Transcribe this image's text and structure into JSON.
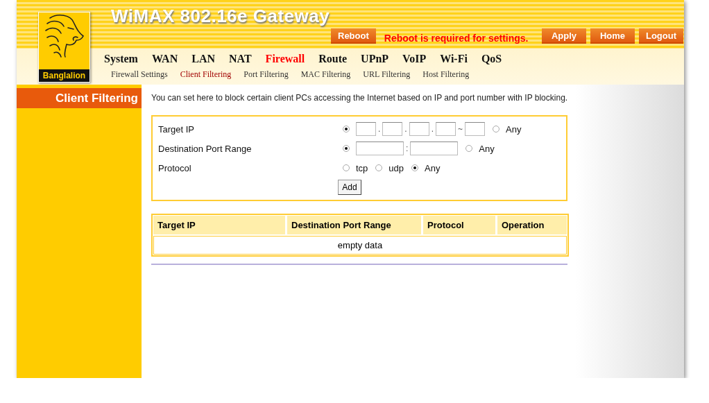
{
  "header": {
    "title": "WiMAX 802.16e Gateway",
    "logo_text": "Banglalion",
    "reboot_button": "Reboot",
    "notice": "Reboot is required for settings.",
    "buttons": [
      "Apply",
      "Home",
      "Logout"
    ],
    "main_menu": [
      {
        "label": "System",
        "selected": false
      },
      {
        "label": "WAN",
        "selected": false
      },
      {
        "label": "LAN",
        "selected": false
      },
      {
        "label": "NAT",
        "selected": false
      },
      {
        "label": "Firewall",
        "selected": true
      },
      {
        "label": "Route",
        "selected": false
      },
      {
        "label": "UPnP",
        "selected": false
      },
      {
        "label": "VoIP",
        "selected": false
      },
      {
        "label": "Wi-Fi",
        "selected": false
      },
      {
        "label": "QoS",
        "selected": false
      }
    ],
    "sub_menu": [
      {
        "label": "Firewall Settings",
        "selected": false
      },
      {
        "label": "Client Filtering",
        "selected": true
      },
      {
        "label": "Port Filtering",
        "selected": false
      },
      {
        "label": "MAC Filtering",
        "selected": false
      },
      {
        "label": "URL Filtering",
        "selected": false
      },
      {
        "label": "Host Filtering",
        "selected": false
      }
    ]
  },
  "sidebar": {
    "title": "Client Filtering"
  },
  "description": "You can set here to block certain client PCs accessing the Internet based on IP and port number with IP blocking.",
  "form": {
    "rows": [
      {
        "kind": "ip",
        "label": "Target IP",
        "fields_selected": true,
        "any_selected": false,
        "separators": [
          ".",
          ".",
          ".",
          "~"
        ],
        "any_label": "Any"
      },
      {
        "kind": "port",
        "label": "Destination Port Range",
        "fields_selected": true,
        "any_selected": false,
        "separators": [
          ":"
        ],
        "any_label": "Any"
      },
      {
        "kind": "protocol",
        "label": "Protocol",
        "options": [
          {
            "label": "tcp",
            "selected": false
          },
          {
            "label": "udp",
            "selected": false
          },
          {
            "label": "Any",
            "selected": true
          }
        ]
      }
    ],
    "add_button": "Add"
  },
  "table": {
    "columns": [
      "Target IP",
      "Destination Port Range",
      "Protocol",
      "Operation"
    ],
    "empty_text": "empty data"
  }
}
